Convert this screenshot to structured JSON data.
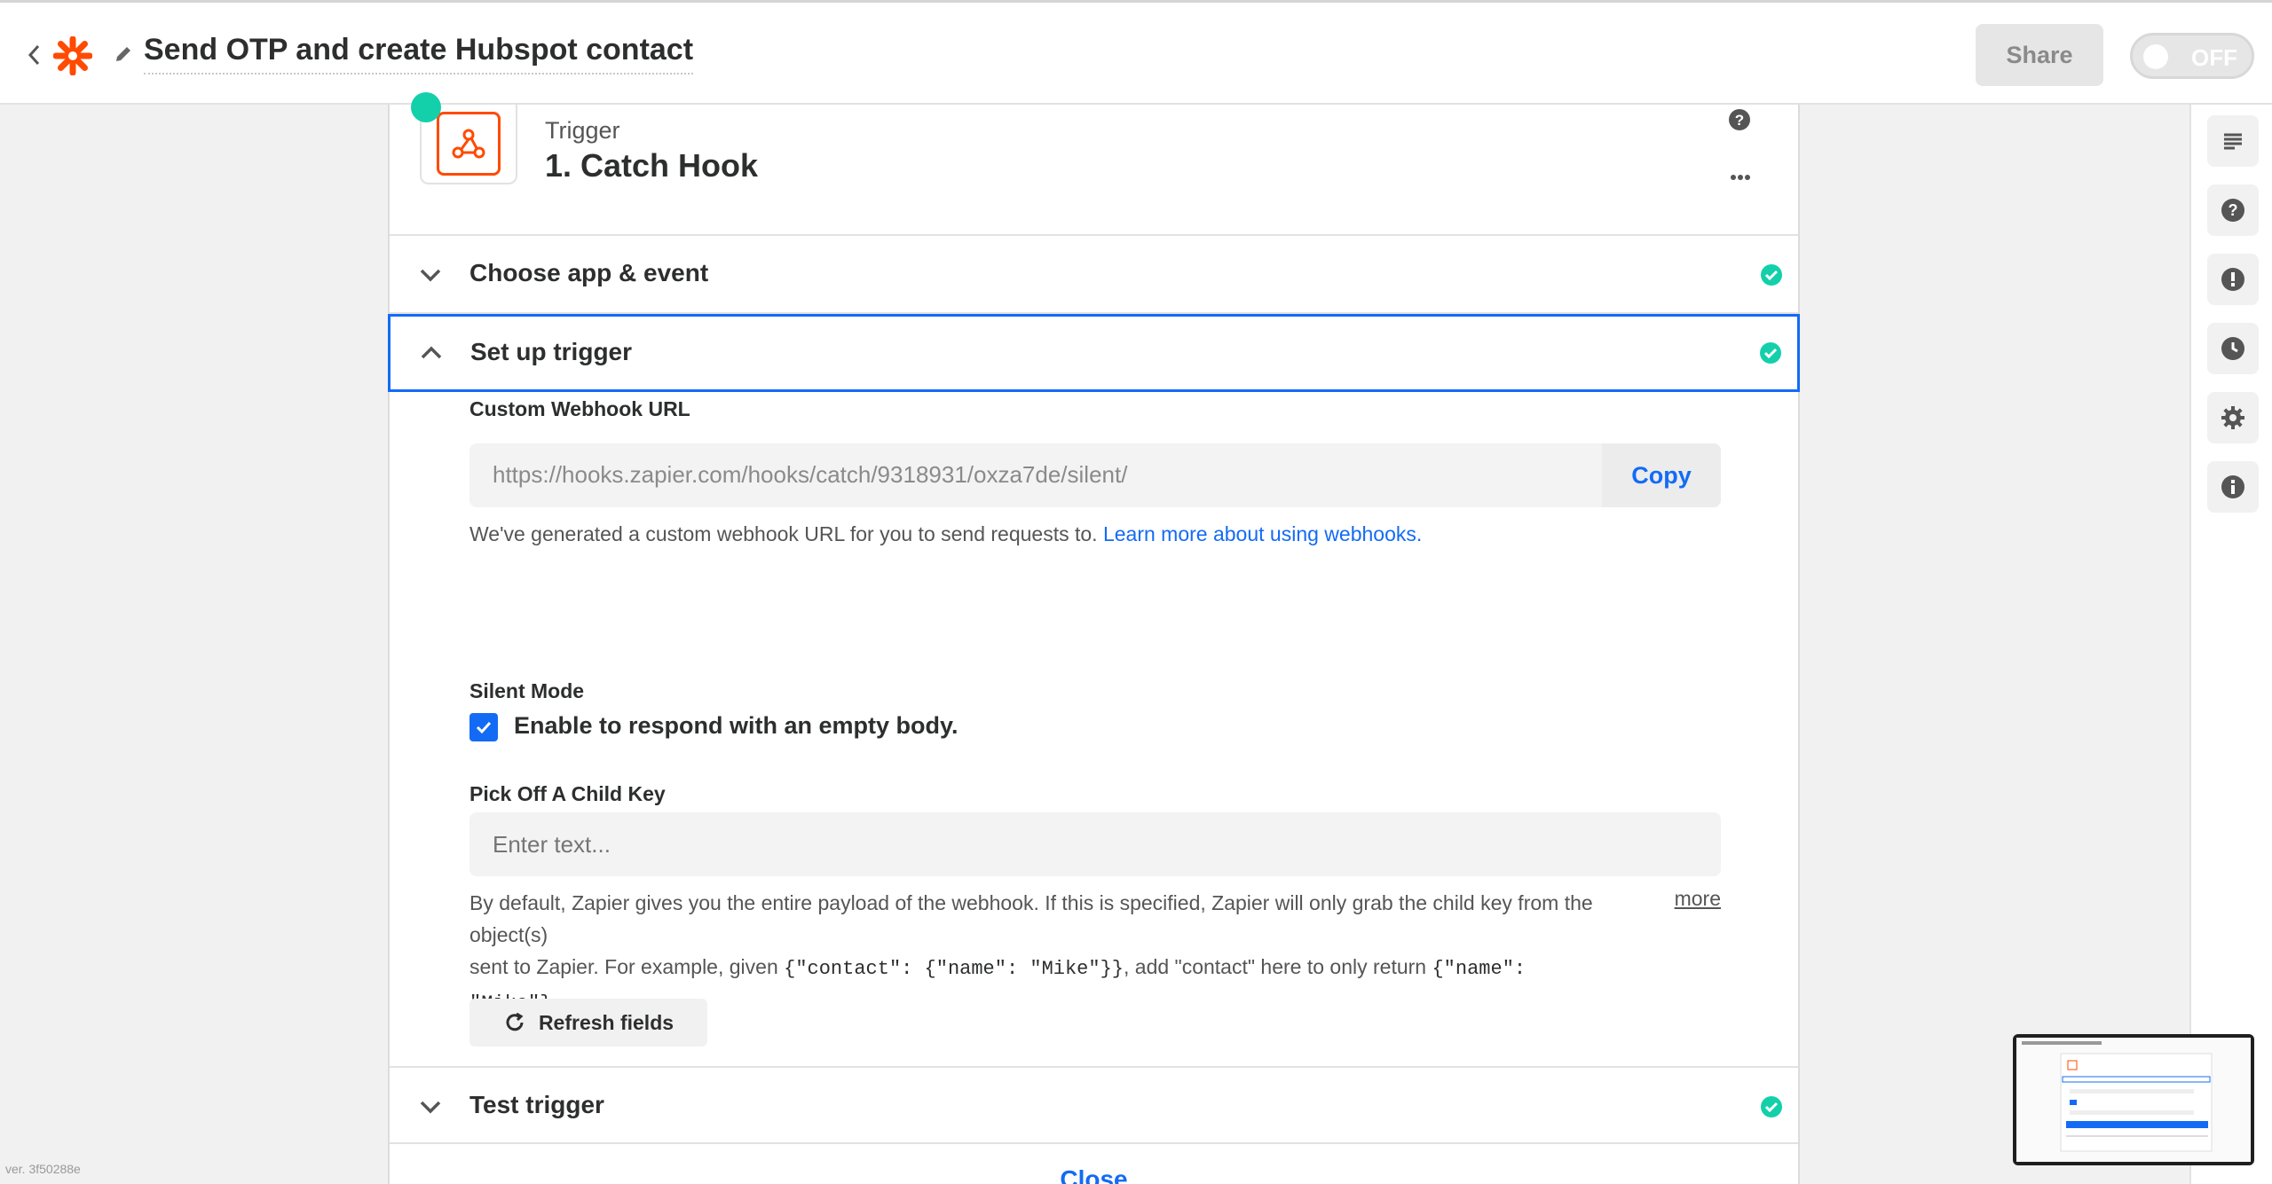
{
  "header": {
    "zap_title": "Send OTP and create Hubspot contact",
    "share_label": "Share",
    "toggle_label": "OFF"
  },
  "step": {
    "type_label": "Trigger",
    "title": "1. Catch Hook"
  },
  "sections": {
    "choose_app": "Choose app & event",
    "setup_trigger": "Set up trigger",
    "test_trigger": "Test trigger"
  },
  "form": {
    "webhook_label": "Custom Webhook URL",
    "webhook_url": "https://hooks.zapier.com/hooks/catch/9318931/oxza7de/silent/",
    "copy_label": "Copy",
    "webhook_help": "We've generated a custom webhook URL for you to send requests to.",
    "webhook_help_link": "Learn more about using webhooks.",
    "silent_label": "Silent Mode",
    "silent_checkbox_label": "Enable to respond with an empty body.",
    "silent_checked": true,
    "child_key_label": "Pick Off A Child Key",
    "child_key_placeholder": "Enter text...",
    "child_help_1": "By default, Zapier gives you the entire payload of the webhook. If this is specified, Zapier will only grab the child key from the object(s)",
    "child_help_2a": "sent to Zapier. For example, given",
    "child_help_code1": "{\"contact\": {\"name\": \"Mike\"}}",
    "child_help_2b": ", add \"contact\" here to only return",
    "child_help_code2": "{\"name\": \"Mike\"}",
    "child_help_2c": "....",
    "more_label": "more",
    "refresh_label": "Refresh fields"
  },
  "close_label": "Close",
  "version": "ver. 3f50288e",
  "sidebar_icons": [
    "list-icon",
    "help-icon",
    "alert-icon",
    "history-icon",
    "settings-icon",
    "info-icon"
  ],
  "colors": {
    "accent": "#136bf5",
    "success": "#13d0ab",
    "brand": "#ff4a00"
  }
}
